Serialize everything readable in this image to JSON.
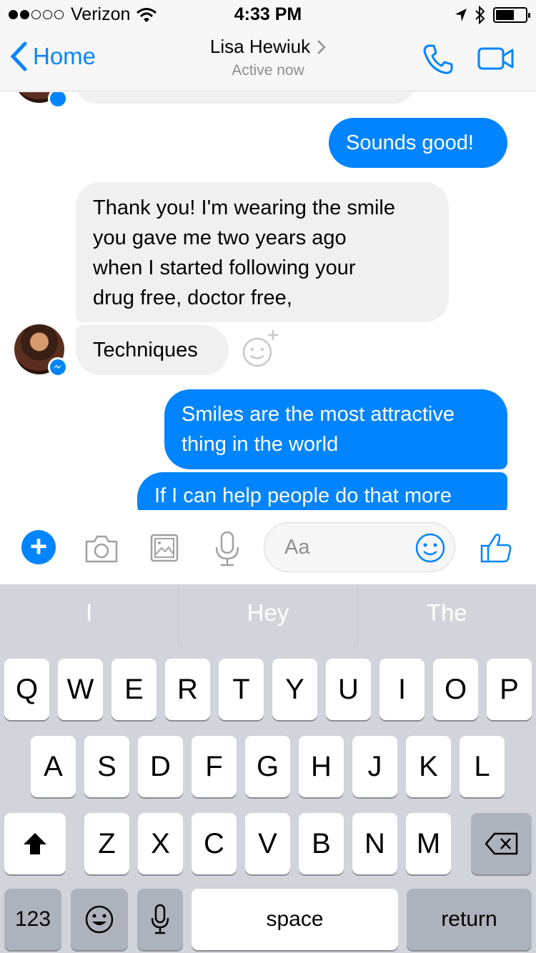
{
  "status": {
    "carrier": "Verizon",
    "time": "4:33 PM"
  },
  "nav": {
    "back_label": "Home",
    "contact_name": "Lisa Hewiuk",
    "presence": "Active now"
  },
  "messages": [
    {
      "from": "them",
      "text": ""
    },
    {
      "from": "me",
      "text": "Sounds good!"
    },
    {
      "from": "them",
      "lines": [
        "Thank you! I'm wearing the smile",
        "you gave me two years ago",
        "when I started following your",
        "drug free, doctor free,"
      ]
    },
    {
      "from": "them",
      "text": "Techniques"
    },
    {
      "from": "me",
      "lines": [
        "Smiles are the most attractive",
        "thing in the world"
      ]
    },
    {
      "from": "me",
      "text": "If I can help people do that more"
    }
  ],
  "composer": {
    "placeholder": "Aa"
  },
  "suggestions": [
    "I",
    "Hey",
    "The"
  ],
  "keyboard": {
    "row1": [
      "Q",
      "W",
      "E",
      "R",
      "T",
      "Y",
      "U",
      "I",
      "O",
      "P"
    ],
    "row2": [
      "A",
      "S",
      "D",
      "F",
      "G",
      "H",
      "J",
      "K",
      "L"
    ],
    "row3": [
      "Z",
      "X",
      "C",
      "V",
      "B",
      "N",
      "M"
    ],
    "numbers_label": "123",
    "space_label": "space",
    "return_label": "return"
  },
  "colors": {
    "accent": "#0084ff",
    "incoming_bubble": "#f1f0f0",
    "keyboard_bg": "#d1d4da"
  }
}
